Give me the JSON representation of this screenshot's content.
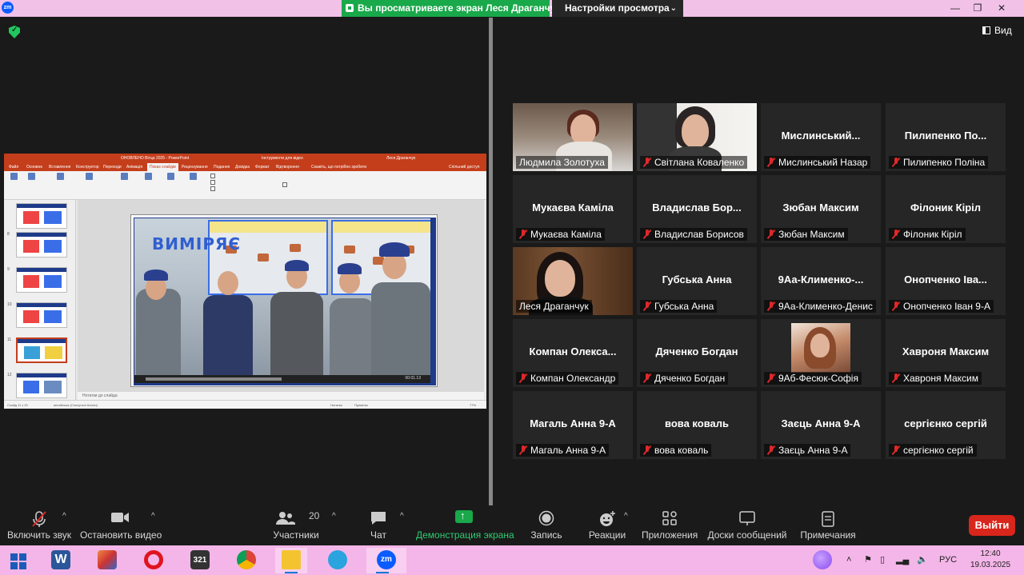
{
  "titlebar": {
    "share_notice": "Вы просматриваете экран Леся Драганчук",
    "view_settings": "Настройки просмотра",
    "logo": "zm"
  },
  "view_button": "Вид",
  "ppt": {
    "file_title": "ОНОВЛЕНО Вітца 2025 - PowerPoint",
    "tools_tab": "Інструменти для відео",
    "user": "Леся Драганчук",
    "menu": [
      "Файл",
      "Основне",
      "Вставлення",
      "Конструктор",
      "Переходи",
      "Анімація",
      "Показ слайдів",
      "Рецензування",
      "Подання",
      "Довідка",
      "Формат",
      "Відтворення"
    ],
    "active_menu": "Показ слайдів",
    "search_hint": "Скажіть, що потрібно зробити",
    "share_hint": "Спільний доступ",
    "slide_title": "ВИМІРЯЄ",
    "notes_placeholder": "Нотатки до слайда",
    "status_left": "Слайд 11 з 20",
    "status_lang": "англійська (Сполучені Штати)",
    "status_notes": "Нотатки",
    "status_comments": "Примітки",
    "zoom": "77%",
    "video_time": "00:01.13",
    "thumb_numbers": [
      "8",
      "9",
      "10",
      "11",
      "12"
    ]
  },
  "participants_tiles": [
    {
      "name": "Людмила Золотуха",
      "big": "",
      "muted": false,
      "video": "cam1"
    },
    {
      "name": "Світлана Коваленко",
      "big": "",
      "muted": true,
      "video": "cam2"
    },
    {
      "name": "Мислинський Назар",
      "big": "Мислинський...",
      "muted": true
    },
    {
      "name": "Пилипенко Поліна",
      "big": "Пилипенко По...",
      "muted": true
    },
    {
      "name": "Мукаєва Каміла",
      "big": "Мукаєва Каміла",
      "muted": true
    },
    {
      "name": "Владислав Борисов",
      "big": "Владислав Бор...",
      "muted": true
    },
    {
      "name": "Зюбан Максим",
      "big": "Зюбан Максим",
      "muted": true
    },
    {
      "name": "Філоник Кіріл",
      "big": "Філоник Кіріл",
      "muted": true
    },
    {
      "name": "Леся Драганчук",
      "big": "",
      "muted": false,
      "video": "cam3",
      "active": true
    },
    {
      "name": "Губська Анна",
      "big": "Губська Анна",
      "muted": true
    },
    {
      "name": "9Аа-Клименко-Денис",
      "big": "9Аа-Клименко-...",
      "muted": true
    },
    {
      "name": "Онопченко Іван 9-А",
      "big": "Онопченко Іва...",
      "muted": true
    },
    {
      "name": "Компан Олександр",
      "big": "Компан Олекса...",
      "muted": true
    },
    {
      "name": "Дяченко Богдан",
      "big": "Дяченко Богдан",
      "muted": true
    },
    {
      "name": "9Аб-Фесюк-Софія",
      "big": "",
      "muted": true,
      "video": "avatar"
    },
    {
      "name": "Хавроня Максим",
      "big": "Хавроня Максим",
      "muted": true
    },
    {
      "name": "Магаль Анна 9-А",
      "big": "Магаль Анна 9-А",
      "muted": true
    },
    {
      "name": "вова коваль",
      "big": "вова коваль",
      "muted": true
    },
    {
      "name": "Заєць Анна 9-А",
      "big": "Заєць Анна 9-А",
      "muted": true
    },
    {
      "name": "сергієнко сергій",
      "big": "сергієнко сергій",
      "muted": true
    }
  ],
  "toolbar": {
    "unmute": "Включить звук",
    "stop_video": "Остановить видео",
    "participants": "Участники",
    "participants_count": "20",
    "chat": "Чат",
    "share_screen": "Демонстрация экрана",
    "record": "Запись",
    "reactions": "Реакции",
    "apps": "Приложения",
    "whiteboards": "Доски сообщений",
    "notes": "Примечания",
    "leave": "Выйти"
  },
  "taskbar": {
    "lang": "РУС",
    "time": "12:40",
    "date": "19.03.2025",
    "zoom_label": "zm",
    "word_label": "W",
    "calc_label": "321"
  },
  "colors": {
    "zoom_blue": "#0b5cff",
    "share_green": "#19a84a",
    "leave_red": "#d9261c",
    "active_speaker": "#e9e27a",
    "ppt_accent": "#c43e1c"
  }
}
